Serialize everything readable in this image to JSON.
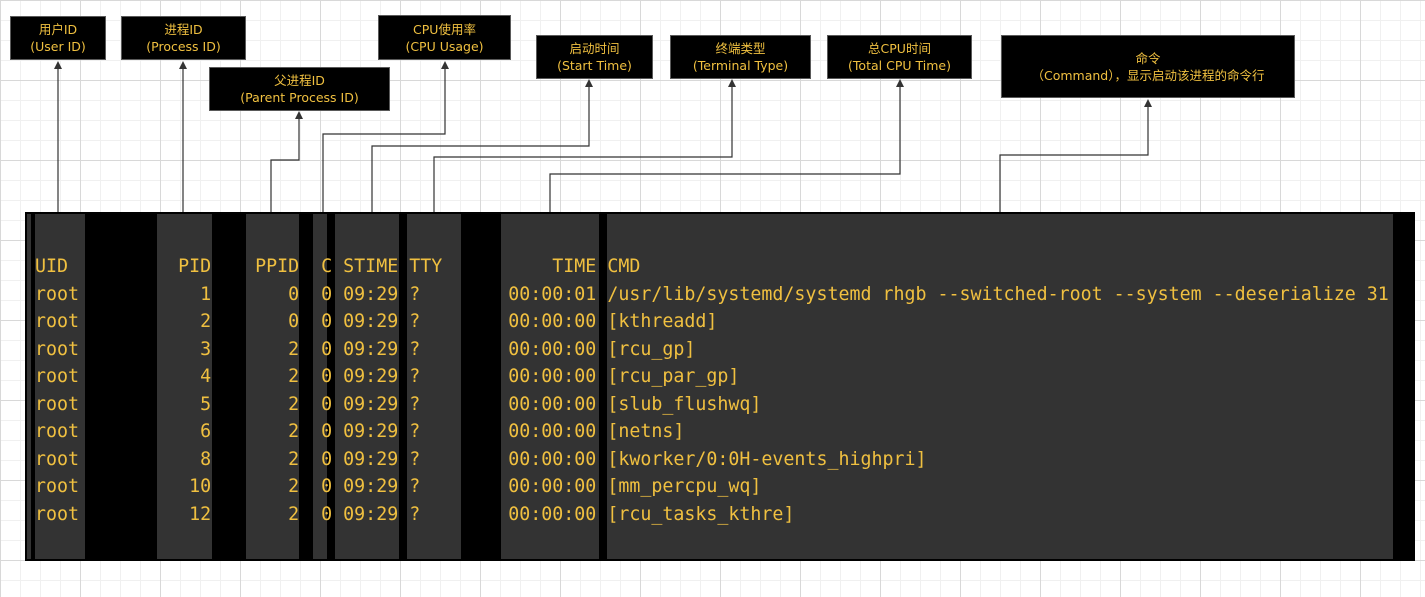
{
  "labels": {
    "uid": {
      "line1": "用户ID",
      "line2": "(User ID)"
    },
    "pid": {
      "line1": "进程ID",
      "line2": "(Process ID)"
    },
    "ppid": {
      "line1": "父进程ID",
      "line2": "(Parent Process ID)"
    },
    "cpu": {
      "line1": "CPU使用率",
      "line2": "(CPU Usage)"
    },
    "stime": {
      "line1": "启动时间",
      "line2": "(Start Time)"
    },
    "tty": {
      "line1": "终端类型",
      "line2": "(Terminal Type)"
    },
    "time": {
      "line1": "总CPU时间",
      "line2": "(Total CPU Time)"
    },
    "cmd": {
      "line1": "命令",
      "line2": "（Command），显示启动该进程的命令行"
    }
  },
  "terminal": {
    "header": "UID          PID    PPID  C STIME TTY          TIME CMD",
    "rows": [
      "root           1       0  0 09:29 ?        00:00:01 /usr/lib/systemd/systemd rhgb --switched-root --system --deserialize 31",
      "root           2       0  0 09:29 ?        00:00:00 [kthreadd]",
      "root           3       2  0 09:29 ?        00:00:00 [rcu_gp]",
      "root           4       2  0 09:29 ?        00:00:00 [rcu_par_gp]",
      "root           5       2  0 09:29 ?        00:00:00 [slub_flushwq]",
      "root           6       2  0 09:29 ?        00:00:00 [netns]",
      "root           8       2  0 09:29 ?        00:00:00 [kworker/0:0H-events_highpri]",
      "root          10       2  0 09:29 ?        00:00:00 [mm_percpu_wq]",
      "root          12       2  0 09:29 ?        00:00:00 [rcu_tasks_kthre]"
    ]
  },
  "colors": {
    "text": "#f0c040",
    "terminal_bg": "#333333",
    "box_bg": "#000000"
  }
}
